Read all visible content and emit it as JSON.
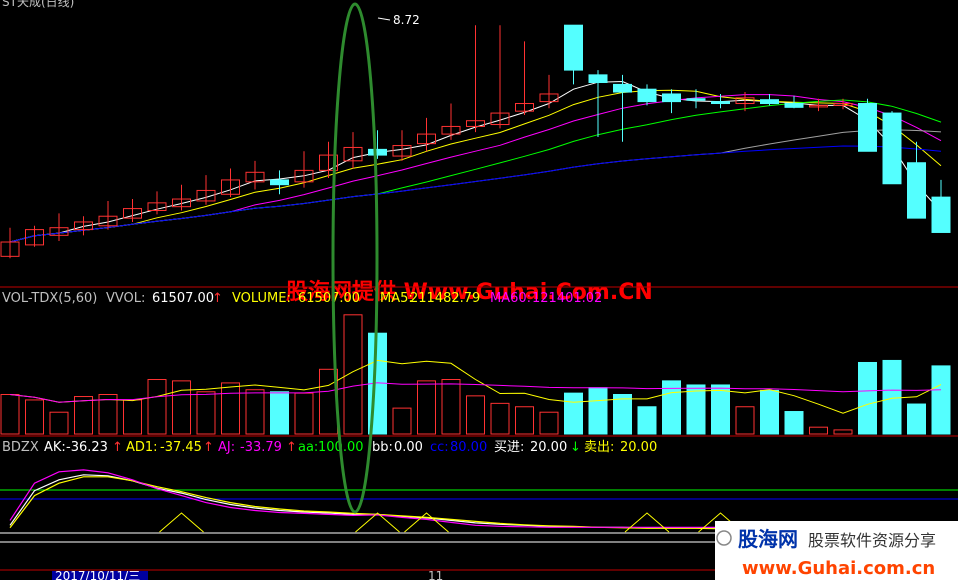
{
  "header": {
    "top_label": "ST天成(日线)",
    "peak_label": "8.72"
  },
  "volume_panel": {
    "title": "VOL-TDX(5,60)",
    "vvol_label": "VVOL:",
    "vvol_value": "61507.00",
    "volume_label": "VOLUME:",
    "volume_value": "61507.00",
    "ma5_label": "MA5:",
    "ma5_value": "211482.79",
    "ma60_label": "MA60:",
    "ma60_value": "121401.02"
  },
  "bdzx_panel": {
    "title": "BDZX",
    "ak_label": "AK:",
    "ak_value": "-36.23",
    "ad1_label": "AD1:",
    "ad1_value": "-37.45",
    "aj_label": "AJ:",
    "aj_value": "-33.79",
    "aa_label": "aa:",
    "aa_value": "100.00",
    "bb_label": "bb:",
    "bb_value": "0.00",
    "cc_label": "cc:",
    "cc_value": "80.00",
    "buy_label": "买进:",
    "buy_value": "20.00",
    "sell_label": "卖出:",
    "sell_value": "20.00"
  },
  "watermark": "股海网提供 Www.Guhai.Com.CN",
  "bottom_logo": {
    "brand": "股海网",
    "slogan": "股票软件资源分享",
    "url": "www.Guhai.com.cn"
  },
  "date_axis": {
    "left_date": "2017/10/11/三",
    "month_tick": "11"
  },
  "colors": {
    "up": "#ff3232",
    "down": "#54ffff",
    "ma_white": "#ffffff",
    "ma_yellow": "#ffff00",
    "ma_magenta": "#ff00ff",
    "ma_green": "#00ff00",
    "ma_gray": "#a0a0a0",
    "ma_blue": "#0000ff",
    "ellipse": "#2e8b2e",
    "panel_line": "#c00000",
    "watermark": "#ff0000"
  },
  "chart_data": [
    {
      "type": "candlestick",
      "x": [
        1,
        2,
        3,
        4,
        5,
        6,
        7,
        8,
        9,
        10,
        11,
        12,
        13,
        14,
        15,
        16,
        17,
        18,
        19,
        20,
        21,
        22,
        23,
        24,
        25,
        26,
        27,
        28,
        29,
        30,
        31,
        32,
        33,
        34,
        35,
        36,
        37,
        38,
        39
      ],
      "open": [
        6.3,
        6.42,
        6.52,
        6.58,
        6.62,
        6.7,
        6.78,
        6.82,
        6.88,
        6.95,
        7.08,
        7.1,
        7.08,
        7.2,
        7.3,
        7.42,
        7.35,
        7.48,
        7.58,
        7.66,
        7.68,
        7.82,
        7.92,
        8.72,
        8.2,
        8.1,
        8.05,
        8.0,
        7.95,
        7.92,
        7.9,
        7.94,
        7.9,
        7.88,
        7.88,
        7.9,
        7.8,
        7.28,
        6.92
      ],
      "high": [
        6.6,
        6.62,
        6.75,
        6.72,
        6.88,
        6.9,
        6.98,
        7.05,
        7.15,
        7.22,
        7.3,
        7.2,
        7.4,
        7.5,
        7.6,
        7.62,
        7.62,
        7.75,
        7.9,
        8.72,
        8.72,
        8.55,
        8.2,
        8.72,
        8.25,
        8.2,
        8.1,
        8.05,
        8.05,
        8.0,
        8.02,
        8.0,
        7.98,
        7.95,
        7.95,
        7.95,
        7.82,
        7.5,
        7.1
      ],
      "low": [
        6.28,
        6.4,
        6.46,
        6.52,
        6.58,
        6.66,
        6.74,
        6.78,
        6.84,
        6.92,
        7.0,
        6.95,
        7.02,
        7.12,
        7.22,
        7.32,
        7.3,
        7.4,
        7.52,
        7.6,
        7.64,
        7.78,
        7.85,
        8.1,
        7.55,
        7.5,
        7.88,
        7.8,
        7.85,
        7.85,
        7.82,
        7.88,
        7.85,
        7.82,
        7.84,
        7.7,
        7.2,
        6.9,
        6.55
      ],
      "close": [
        6.45,
        6.58,
        6.6,
        6.66,
        6.72,
        6.8,
        6.86,
        6.9,
        6.99,
        7.1,
        7.18,
        7.05,
        7.2,
        7.36,
        7.44,
        7.36,
        7.46,
        7.58,
        7.66,
        7.72,
        7.8,
        7.9,
        8.0,
        8.25,
        8.12,
        8.02,
        7.92,
        7.92,
        7.94,
        7.9,
        7.96,
        7.9,
        7.86,
        7.88,
        7.9,
        7.4,
        7.06,
        6.7,
        6.55
      ]
    },
    {
      "type": "bar",
      "title": "VOL-TDX(5,60)",
      "x": [
        1,
        2,
        3,
        4,
        5,
        6,
        7,
        8,
        9,
        10,
        11,
        12,
        13,
        14,
        15,
        16,
        17,
        18,
        19,
        20,
        21,
        22,
        23,
        24,
        25,
        26,
        27,
        28,
        29,
        30,
        31,
        32,
        33,
        34,
        35,
        36,
        37,
        38,
        39
      ],
      "values": [
        58,
        50,
        32,
        55,
        58,
        50,
        80,
        78,
        62,
        75,
        65,
        62,
        60,
        95,
        175,
        148,
        38,
        78,
        80,
        56,
        45,
        40,
        32,
        60,
        68,
        58,
        40,
        78,
        72,
        72,
        40,
        64,
        33,
        10,
        6,
        105,
        108,
        44,
        100
      ]
    },
    {
      "type": "line",
      "title": "BDZX",
      "x": [
        1,
        2,
        3,
        4,
        5,
        6,
        7,
        8,
        9,
        10,
        11,
        12,
        13,
        14,
        15,
        16,
        17,
        18,
        19,
        20,
        21,
        22,
        23,
        24,
        25,
        26,
        27,
        28,
        29,
        30,
        31,
        32,
        33,
        34,
        35,
        36,
        37,
        38,
        39
      ],
      "series": [
        {
          "name": "AK",
          "values": [
            -30,
            40,
            62,
            72,
            70,
            60,
            45,
            35,
            22,
            12,
            5,
            0,
            -3,
            -5,
            -8,
            -8,
            -12,
            -15,
            -20,
            -25,
            -28,
            -30,
            -32,
            -33,
            -34,
            -34,
            -35,
            -35,
            -35,
            -35,
            -36,
            -36,
            -36,
            -36,
            -36,
            -36,
            -36,
            -36,
            -36
          ]
        },
        {
          "name": "AD1",
          "values": [
            -35,
            30,
            55,
            68,
            68,
            60,
            48,
            38,
            26,
            16,
            8,
            3,
            -1,
            -3,
            -6,
            -8,
            -11,
            -14,
            -18,
            -22,
            -26,
            -29,
            -31,
            -32,
            -34,
            -35,
            -36,
            -36,
            -36,
            -37,
            -37,
            -37,
            -37,
            -37,
            -37,
            -37,
            -37,
            -37,
            -37
          ]
        },
        {
          "name": "AJ",
          "values": [
            -20,
            55,
            78,
            82,
            76,
            62,
            44,
            30,
            16,
            6,
            0,
            -4,
            -6,
            -8,
            -10,
            -9,
            -14,
            -18,
            -24,
            -30,
            -32,
            -33,
            -34,
            -34,
            -34,
            -34,
            -34,
            -34,
            -34,
            -34,
            -34,
            -34,
            -34,
            -34,
            -34,
            -34,
            -34,
            -34,
            -34
          ]
        }
      ]
    }
  ]
}
